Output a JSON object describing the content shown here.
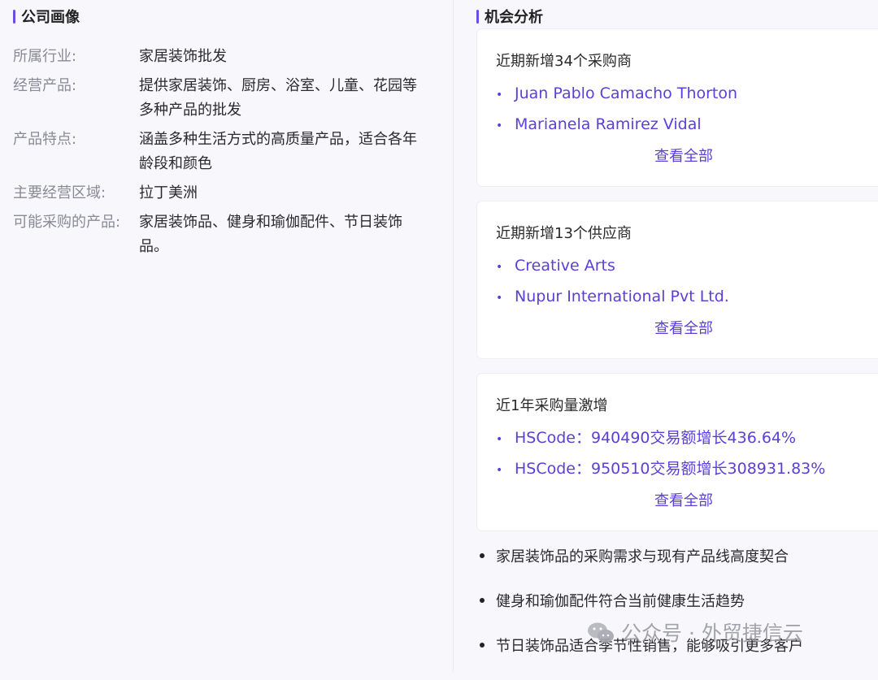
{
  "profile": {
    "title": "公司画像",
    "rows": [
      {
        "label": "所属行业:",
        "value": "家居装饰批发"
      },
      {
        "label": "经营产品:",
        "value": "提供家居装饰、厨房、浴室、儿童、花园等多种产品的批发"
      },
      {
        "label": "产品特点:",
        "value": "涵盖多种生活方式的高质量产品，适合各年龄段和颜色"
      },
      {
        "label": "主要经营区域:",
        "value": "拉丁美洲"
      },
      {
        "label": "可能采购的产品:",
        "value": "家居装饰品、健身和瑜伽配件、节日装饰品。"
      }
    ]
  },
  "opportunity": {
    "title": "机会分析",
    "cards": [
      {
        "heading": "近期新增34个采购商",
        "items": [
          "Juan Pablo Camacho Thorton",
          "Marianela Ramirez Vidal"
        ],
        "more": "查看全部"
      },
      {
        "heading": "近期新增13个供应商",
        "items": [
          "Creative Arts",
          "Nupur International Pvt Ltd."
        ],
        "more": "查看全部"
      },
      {
        "heading": "近1年采购量激增",
        "items": [
          "HSCode：940490交易额增长436.64%",
          "HSCode：950510交易额增长308931.83%"
        ],
        "more": "查看全部"
      }
    ],
    "insights": [
      "家居装饰品的采购需求与现有产品线高度契合",
      "健身和瑜伽配件符合当前健康生活趋势",
      "节日装饰品适合季节性销售，能够吸引更多客户"
    ]
  },
  "watermark": {
    "text": "公众号 · 外贸捷信云",
    "icon": "wechat-icon"
  },
  "colors": {
    "accent": "#5b3fd6",
    "title_bar": "#6b4ee6",
    "background": "#f7f7fc"
  }
}
